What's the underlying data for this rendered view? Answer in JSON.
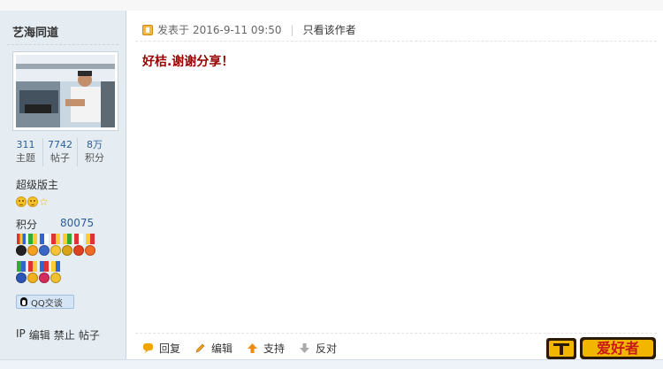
{
  "user": {
    "name": "艺海同道",
    "stats": [
      {
        "value": "311",
        "label": "主题"
      },
      {
        "value": "7742",
        "label": "帖子"
      },
      {
        "value": "8万",
        "label": "积分"
      }
    ],
    "rank": "超级版主",
    "score_label": "积分",
    "score_value": "80075",
    "qq_label": "QQ交谈",
    "admin_links": [
      "IP",
      "编辑",
      "禁止",
      "帖子"
    ]
  },
  "post": {
    "posted_label": "发表于",
    "datetime": "2016-9-11 09:50",
    "separator": "|",
    "only_author": "只看该作者",
    "content": "好桔.谢谢分享！"
  },
  "actions": {
    "reply": "回复",
    "edit": "编辑",
    "support": "支持",
    "oppose": "反对"
  },
  "logo_text": "爱好者",
  "colors": {
    "sidebar_bg": "#e5edf2",
    "link_blue": "#2a5d99",
    "content_red": "#990000"
  }
}
